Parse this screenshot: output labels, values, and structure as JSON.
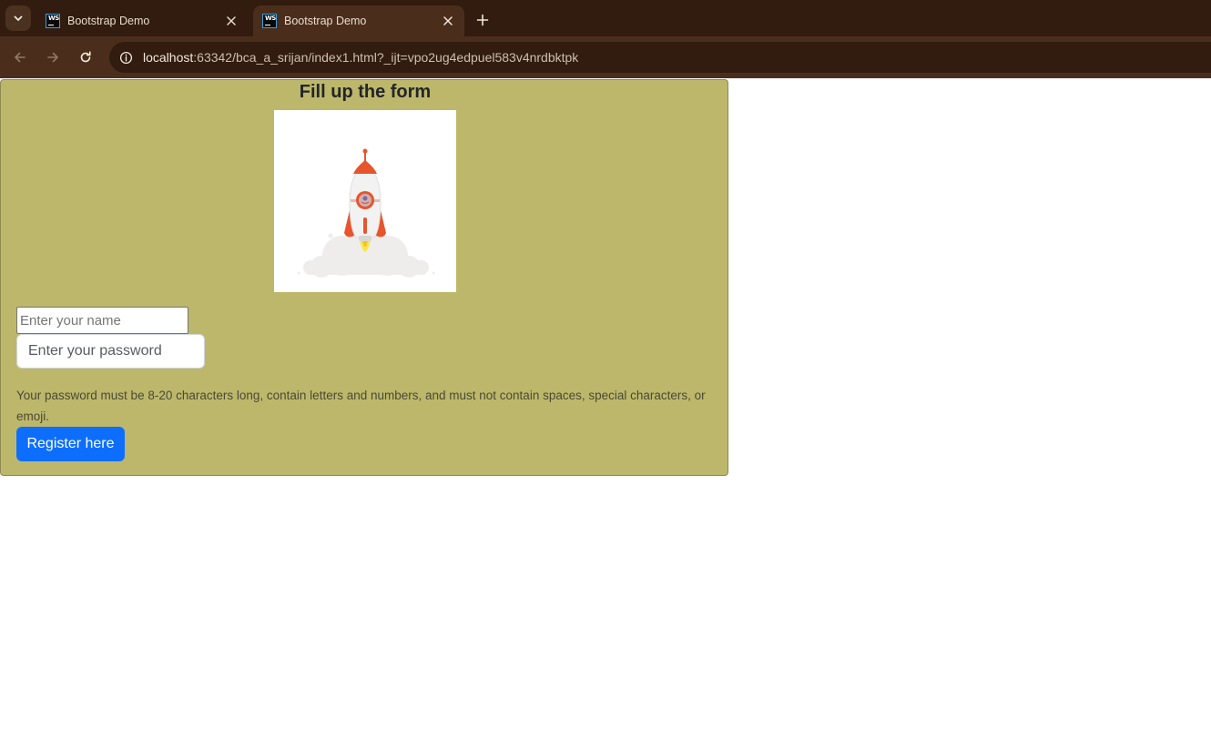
{
  "browser": {
    "tabs": [
      {
        "title": "Bootstrap Demo",
        "favicon": "webstorm-icon",
        "active": false
      },
      {
        "title": "Bootstrap Demo",
        "favicon": "webstorm-icon",
        "active": true
      }
    ],
    "favicon_text": "WS",
    "address": {
      "host": "localhost",
      "path": ":63342/bca_a_srijan/index1.html?_ijt=vpo2ug4edpuel583v4nrdbktpk"
    },
    "icons": {
      "tab_search": "chevron-down-icon",
      "close_tab": "close-icon",
      "new_tab": "plus-icon",
      "back": "arrow-left-icon",
      "forward": "arrow-right-icon",
      "reload": "reload-icon",
      "site_info": "info-icon"
    }
  },
  "form": {
    "title": "Fill up the form",
    "image": "rocket-launch-illustration",
    "name_placeholder": "Enter your name",
    "password_placeholder": "Enter your password",
    "password_help": "Your password must be 8-20 characters long, contain letters and numbers, and must not contain spaces, special characters, or emoji.",
    "submit_label": "Register here"
  },
  "colors": {
    "card_background": "#bdb76b",
    "button_primary": "#0d6efd",
    "chrome_dark": "#311c0f",
    "chrome_toolbar": "#4a2e1b"
  }
}
